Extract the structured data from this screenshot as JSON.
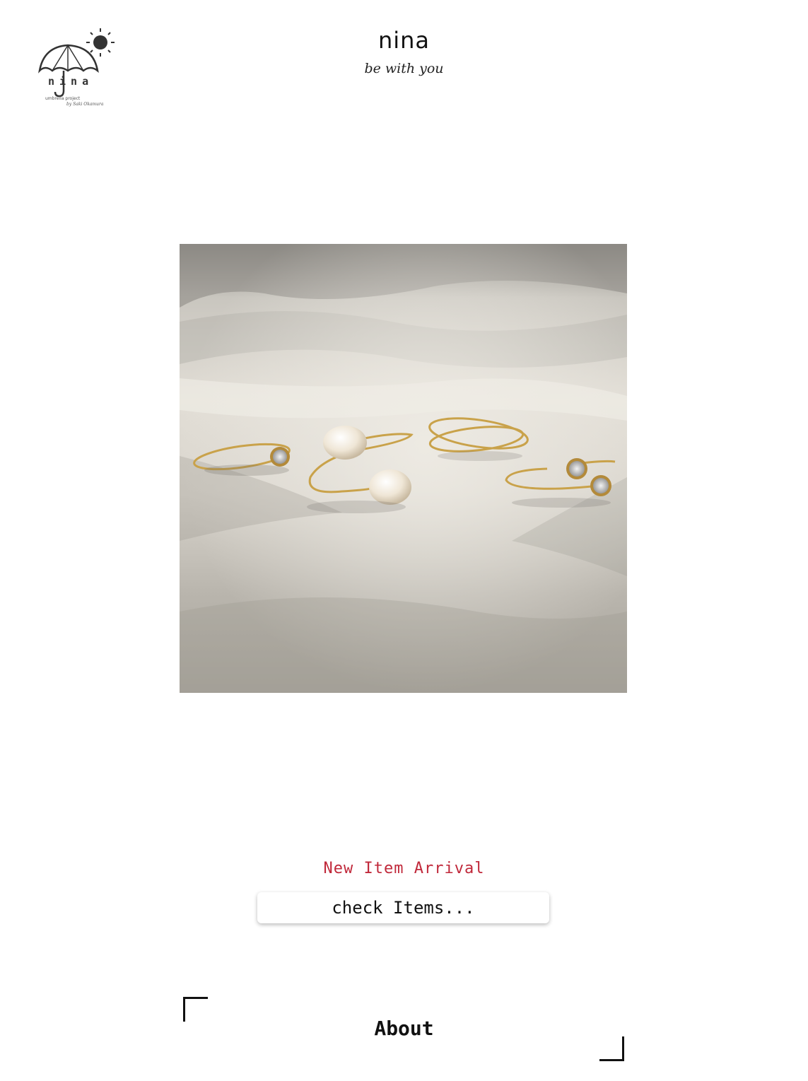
{
  "header": {
    "logo": {
      "icon": "umbrella-sun-icon",
      "wordmark": "nina",
      "subtitle": "umbrella project",
      "signature": "by Saki Okamura"
    },
    "title": "nina",
    "tagline": "be with you"
  },
  "hero": {
    "image": "gold-rings-on-linen-photo",
    "accent_color": "#c9a24a"
  },
  "promo": {
    "label": "New Item Arrival",
    "label_color": "#c0283a",
    "button_label": "check Items..."
  },
  "about": {
    "heading": "About"
  }
}
